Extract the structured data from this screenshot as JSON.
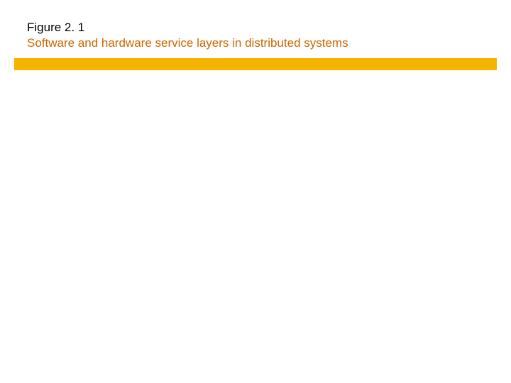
{
  "figure": {
    "label": "Figure 2. 1",
    "title": "Software and hardware service layers in distributed systems"
  },
  "colors": {
    "title_color": "#cc6600",
    "divider_color": "#f4b400"
  }
}
